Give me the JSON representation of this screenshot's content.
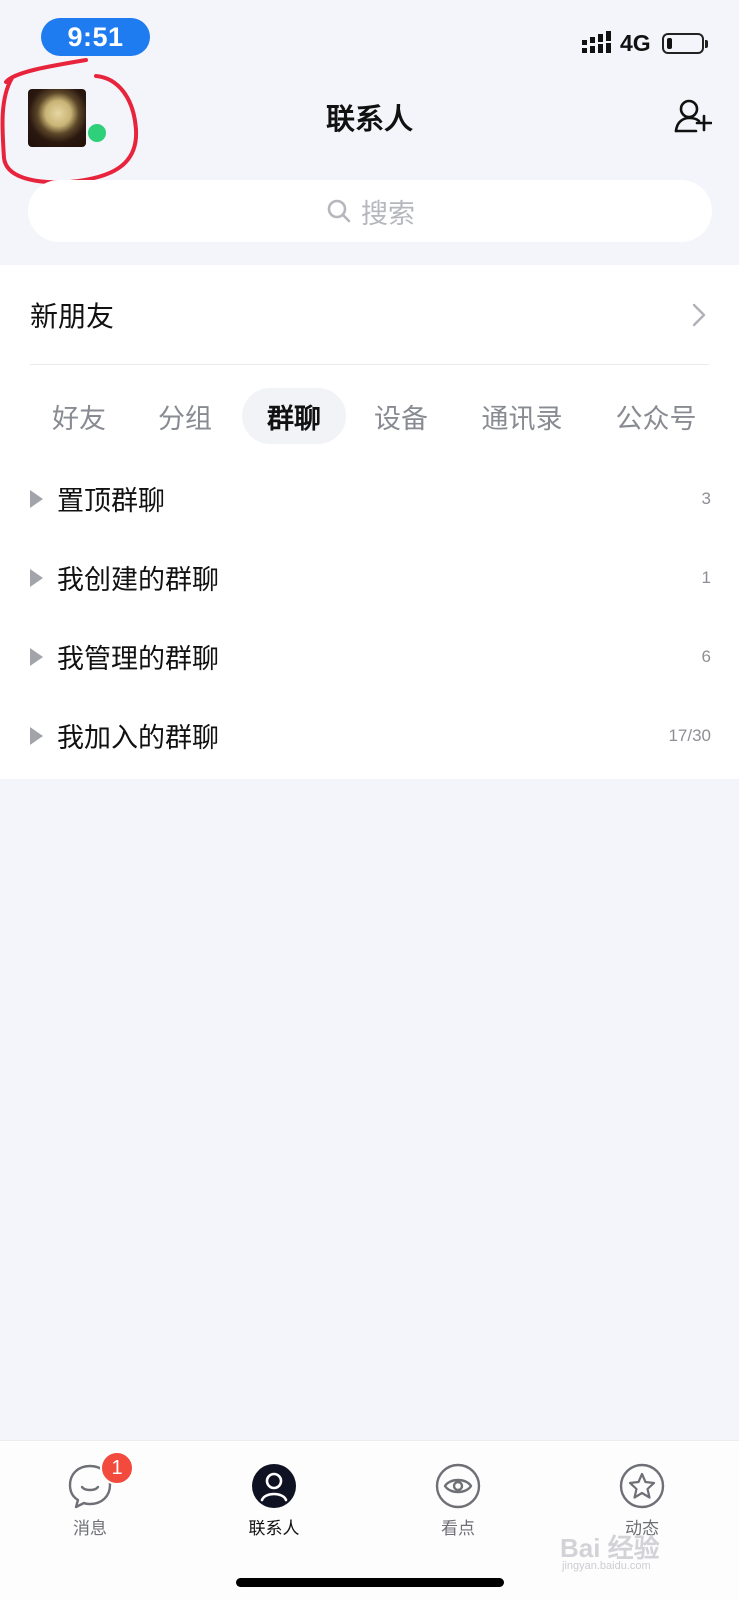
{
  "status_bar": {
    "time": "9:51",
    "network": "4G",
    "battery_level": 0.15
  },
  "header": {
    "title": "联系人",
    "avatar_status": "online",
    "add_friend_icon": "add-person-icon"
  },
  "search": {
    "placeholder": "搜索"
  },
  "new_friends": {
    "label": "新朋友"
  },
  "tabs": [
    {
      "label": "好友",
      "active": false
    },
    {
      "label": "分组",
      "active": false
    },
    {
      "label": "群聊",
      "active": true
    },
    {
      "label": "设备",
      "active": false
    },
    {
      "label": "通讯录",
      "active": false
    },
    {
      "label": "公众号",
      "active": false
    }
  ],
  "groups": [
    {
      "label": "置顶群聊",
      "count": "3"
    },
    {
      "label": "我创建的群聊",
      "count": "1"
    },
    {
      "label": "我管理的群聊",
      "count": "6"
    },
    {
      "label": "我加入的群聊",
      "count": "17/30"
    }
  ],
  "tab_bar": [
    {
      "label": "消息",
      "icon": "chat-bubble-icon",
      "badge": "1",
      "active": false
    },
    {
      "label": "联系人",
      "icon": "contact-icon",
      "badge": "",
      "active": true
    },
    {
      "label": "看点",
      "icon": "eye-icon",
      "badge": "",
      "active": false
    },
    {
      "label": "动态",
      "icon": "star-icon",
      "badge": "",
      "active": false
    }
  ],
  "watermark": {
    "brand": "Bai  经验",
    "url": "jingyan.baidu.com"
  },
  "colors": {
    "accent": "#1f7cf0",
    "online": "#2fd07a",
    "badge": "#f24a3c",
    "annotation": "#e8243c"
  }
}
